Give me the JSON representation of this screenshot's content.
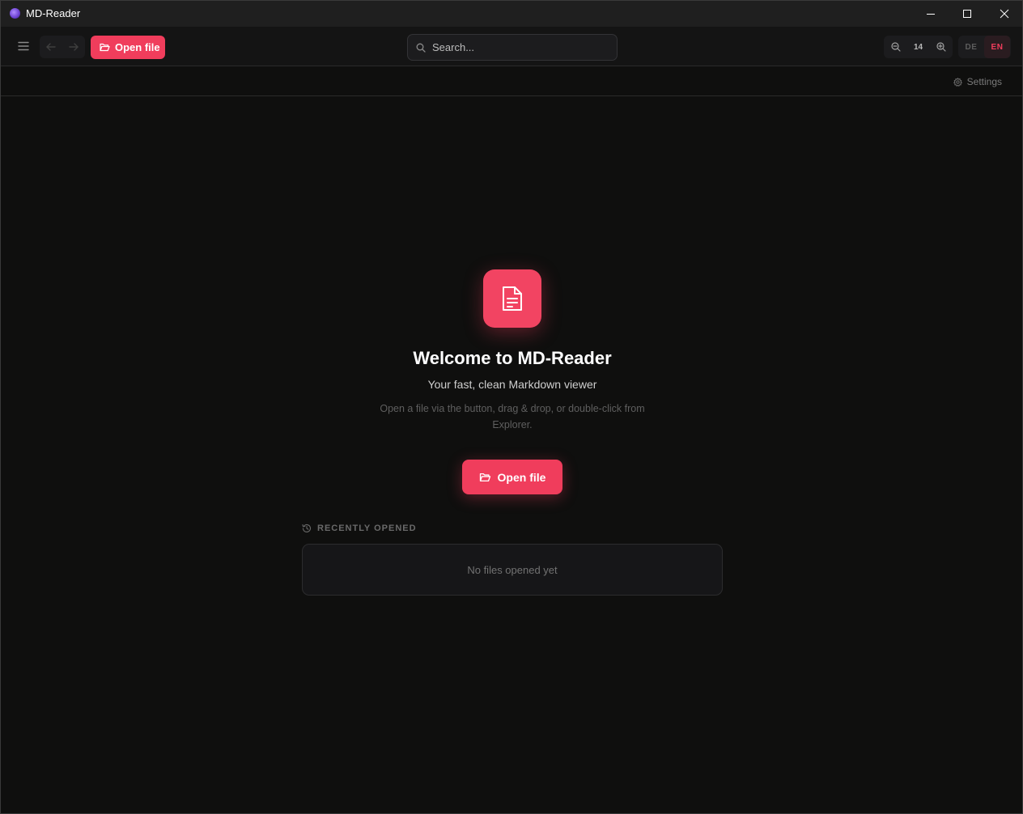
{
  "window": {
    "title": "MD-Reader",
    "icon": "md-reader-app-icon"
  },
  "toolbar": {
    "open_label": "Open file",
    "search_placeholder": "Search...",
    "zoom_value": "14",
    "languages": [
      "DE",
      "EN"
    ],
    "active_language": "EN"
  },
  "subbar": {
    "settings_label": "Settings"
  },
  "welcome": {
    "title": "Welcome to MD-Reader",
    "subtitle": "Your fast, clean Markdown viewer",
    "hint": "Open a file via the button, drag & drop, or double-click from Explorer.",
    "open_label": "Open file"
  },
  "recent": {
    "label": "RECENTLY OPENED",
    "empty_text": "No files opened yet"
  },
  "colors": {
    "accent": "#f03d5c",
    "background": "#0f0f0e",
    "titlebar": "#1f1f1f"
  }
}
